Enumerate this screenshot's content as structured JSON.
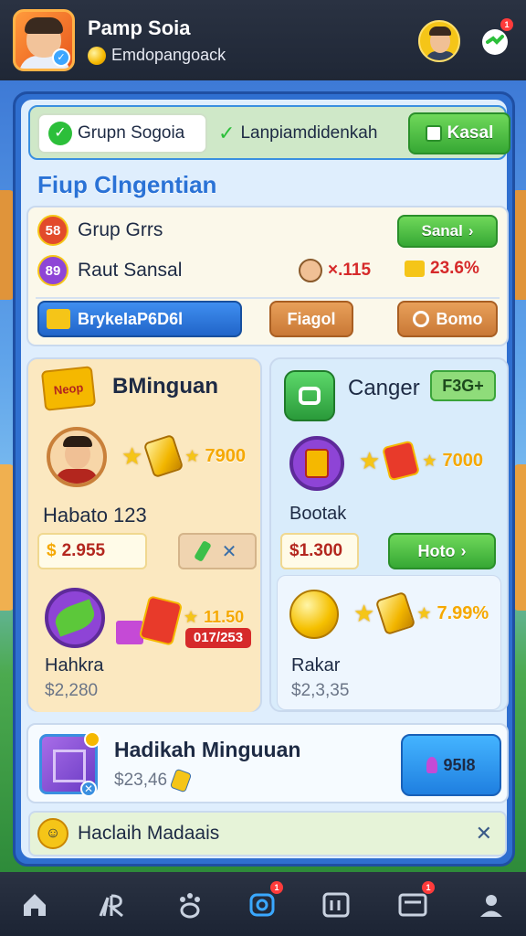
{
  "header": {
    "player_name": "Pamp Soia",
    "player_subtitle": "Emdopangoack",
    "app_badge": "1"
  },
  "tabs": {
    "active_label": "Grupn Sogoia",
    "mid_label": "Lanpiamdidenkah",
    "button_label": "Kasal"
  },
  "section_title": "Fiup Clngentian",
  "group": {
    "row1_label": "Grup Grrs",
    "row1_icon_text": "58",
    "row2_label": "Raut Sansal",
    "row2_icon_text": "89",
    "send_label": "Sanal",
    "stat1": "×.115",
    "stat2": "23.6%",
    "blue_pill_label": "BrykeIaP6D6l",
    "orange_pill_label": "Fiagol",
    "orange_pill2_label": "Bomo"
  },
  "card_left": {
    "title": "BMinguan",
    "badge_text": "Neop",
    "reward1": "7900",
    "item1_label": "Habato 123",
    "item1_price": "2.955",
    "reward2_value": "11.50",
    "reward2_tag": "017/253",
    "item2_label": "Hahkra",
    "item2_price": "$2,280"
  },
  "card_right": {
    "title": "Canger",
    "tag": "F3G+",
    "reward1": "7000",
    "item1_label": "Bootak",
    "item1_price": "$1.300",
    "button_label": "Hoto",
    "reward2": "7.99%",
    "item2_label": "Rakar",
    "item2_price": "$2,3,35"
  },
  "weekly_gift": {
    "title": "Hadikah Minguuan",
    "price": "$23,46",
    "button_label": "95I8"
  },
  "bottom_row": {
    "label": "Haclaih Madaais"
  },
  "nav": {
    "badge1": "1",
    "badge2": "1"
  },
  "colors": {
    "panel_blue": "#2f6fd0",
    "accent_green": "#36a834",
    "accent_red": "#d62a2a",
    "gold": "#f5c518"
  }
}
